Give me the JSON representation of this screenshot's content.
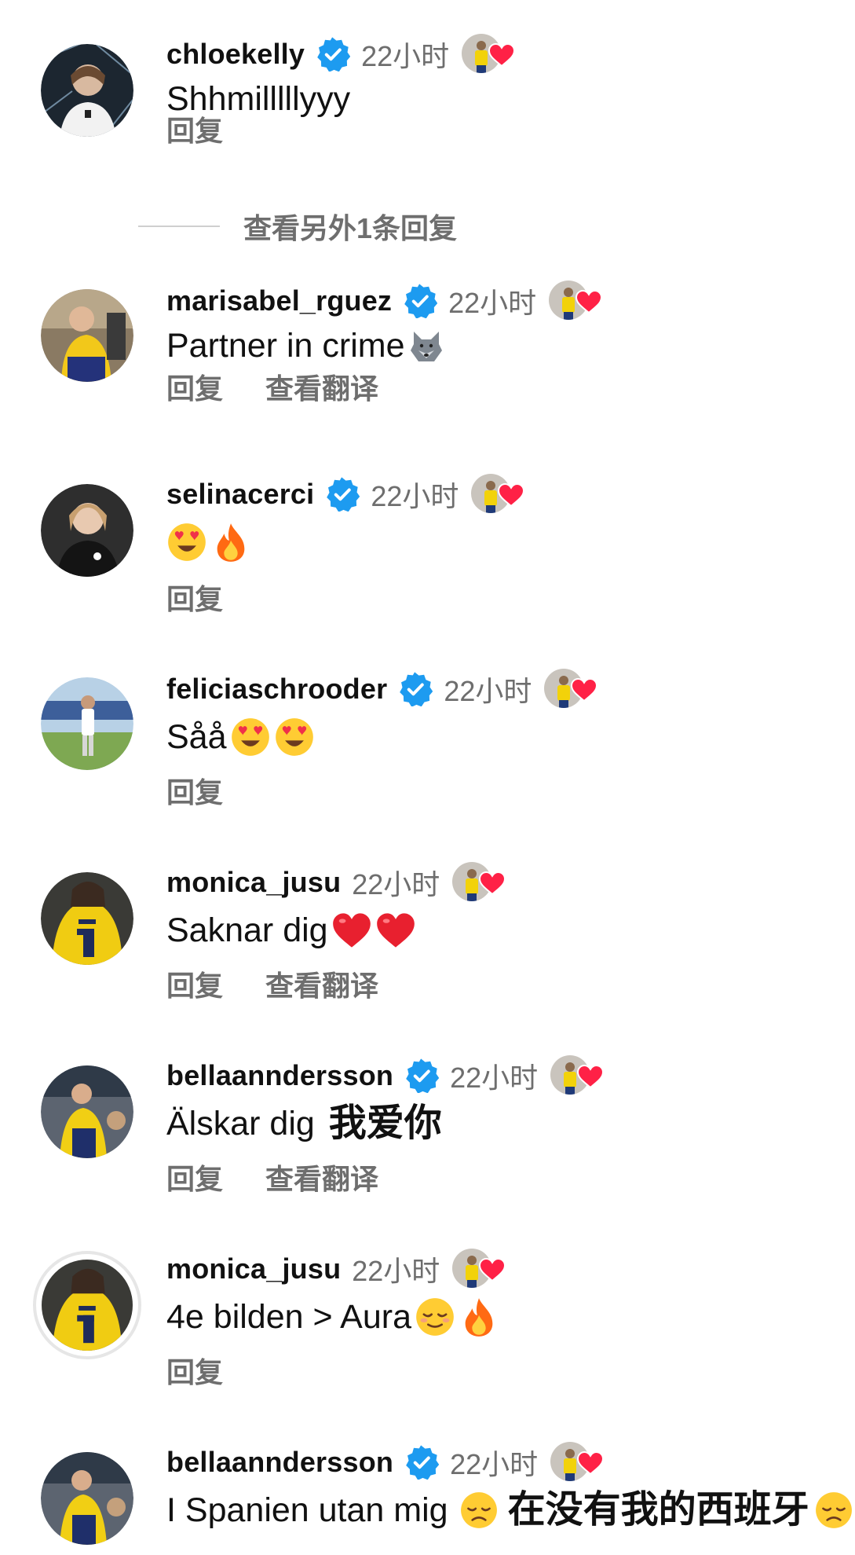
{
  "time_label": "22小时",
  "reply_label": "回复",
  "translate_label": "查看翻译",
  "more_replies_label": "查看另外1条回复",
  "colors": {
    "verified": "#1d9bf0",
    "heart": "#ff2146",
    "secondary_text": "#6e6e6e"
  },
  "comments": [
    {
      "username": "chloekelly",
      "verified": true,
      "text": "Shhmilllllyyy",
      "cjk": "",
      "emojis": []
    },
    {
      "username": "marisabel_rguez",
      "verified": true,
      "text": "Partner in crime",
      "cjk": "",
      "emojis": [
        "wolf-emoji"
      ]
    },
    {
      "username": "selinacerci",
      "verified": true,
      "text": "",
      "cjk": "",
      "emojis": [
        "heart-eyes-emoji",
        "fire-emoji"
      ]
    },
    {
      "username": "feliciaschrooder",
      "verified": true,
      "text": "Såå",
      "cjk": "",
      "emojis": [
        "heart-eyes-emoji",
        "heart-eyes-emoji"
      ]
    },
    {
      "username": "monica_jusu",
      "verified": false,
      "text": "Saknar dig",
      "cjk": "",
      "emojis": [
        "red-heart-emoji",
        "red-heart-emoji"
      ]
    },
    {
      "username": "bellaanndersson",
      "verified": true,
      "text": "Älskar dig",
      "cjk": "我爱你",
      "emojis": []
    },
    {
      "username": "monica_jusu",
      "verified": false,
      "text": "4e bilden > Aura",
      "cjk": "",
      "emojis": [
        "relieved-face-emoji",
        "fire-emoji"
      ]
    },
    {
      "username": "bellaanndersson",
      "verified": true,
      "text": "I Spanien utan mig",
      "cjk": "在没有我的西班牙",
      "emojis": [
        "disappointed-face-emoji",
        "disappointed-face-emoji"
      ]
    }
  ]
}
